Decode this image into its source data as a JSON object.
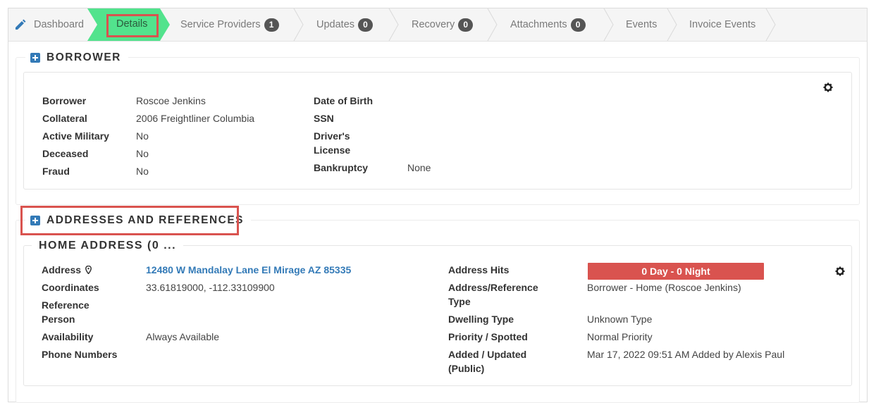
{
  "tabs": [
    {
      "label": "Dashboard",
      "icon": "pencil-icon"
    },
    {
      "label": "Details",
      "active": true
    },
    {
      "label": "Service Providers",
      "badge": "1"
    },
    {
      "label": "Updates",
      "badge": "0"
    },
    {
      "label": "Recovery",
      "badge": "0"
    },
    {
      "label": "Attachments",
      "badge": "0"
    },
    {
      "label": "Events"
    },
    {
      "label": "Invoice Events"
    }
  ],
  "colors": {
    "active_tab": "#52e38d",
    "highlight": "#d9534f",
    "link": "#337ab7",
    "badge": "#555555"
  },
  "borrower": {
    "title": "BORROWER",
    "left": [
      {
        "label": "Borrower",
        "value": "Roscoe Jenkins"
      },
      {
        "label": "Collateral",
        "value": "2006 Freightliner Columbia"
      },
      {
        "label": "Active Military",
        "value": "No"
      },
      {
        "label": "Deceased",
        "value": "No"
      },
      {
        "label": "Fraud",
        "value": "No"
      }
    ],
    "right": [
      {
        "label": "Date of Birth",
        "value": ""
      },
      {
        "label": "SSN",
        "value": ""
      },
      {
        "label": "Driver's License",
        "value": ""
      },
      {
        "label": "Bankruptcy",
        "value": "None"
      }
    ]
  },
  "addresses": {
    "title": "ADDRESSES AND REFERENCES",
    "home": {
      "title": "HOME ADDRESS (0 ...",
      "address_label": "Address",
      "address_value": "12480 W Mandalay Lane El Mirage AZ 85335",
      "coordinates_label": "Coordinates",
      "coordinates_value": "33.61819000, -112.33109900",
      "reference_label": "Reference Person",
      "availability_label": "Availability",
      "availability_value": "Always Available",
      "phone_label": "Phone Numbers",
      "hits_label": "Address Hits",
      "hits_value": "0 Day - 0 Night",
      "type_label": "Address/Reference Type",
      "type_value": "Borrower - Home (Roscoe Jenkins)",
      "dwelling_label": "Dwelling Type",
      "dwelling_value": "Unknown Type",
      "priority_label": "Priority / Spotted",
      "priority_value": "Normal Priority",
      "added_label": "Added / Updated (Public)",
      "added_value": "Mar 17, 2022 09:51 AM Added by Alexis Paul"
    }
  }
}
